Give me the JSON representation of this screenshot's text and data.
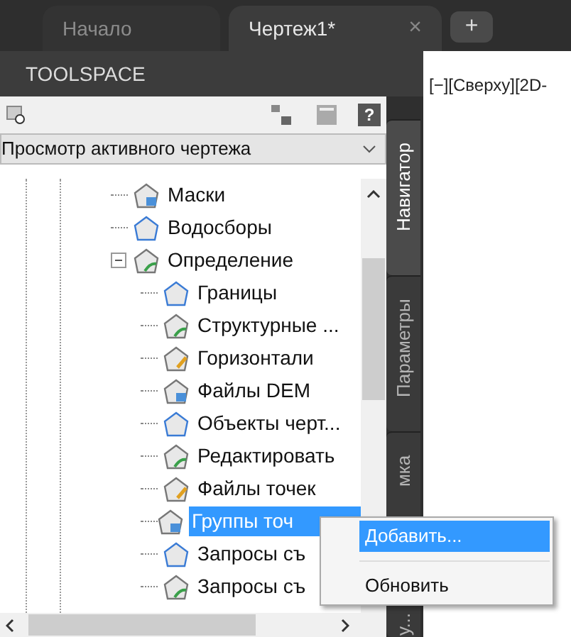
{
  "doc_tabs": [
    {
      "label": "Начало",
      "selected": false
    },
    {
      "label": "Чертеж1*",
      "selected": true,
      "close": "×"
    }
  ],
  "new_tab": "+",
  "panel": {
    "title": "TOOLSPACE",
    "help": "?",
    "view_select": {
      "value": "Просмотр активного чертежа"
    }
  },
  "tree": [
    {
      "label": "Маски",
      "selected": false
    },
    {
      "label": "Водосборы",
      "selected": false
    },
    {
      "label": "Определение",
      "selected": false,
      "expanded": true,
      "children": [
        {
          "label": "Границы",
          "selected": false
        },
        {
          "label": "Структурные ...",
          "selected": false
        },
        {
          "label": "Горизонтали",
          "selected": false
        },
        {
          "label": "Файлы DEM",
          "selected": false
        },
        {
          "label": "Объекты черт...",
          "selected": false
        },
        {
          "label": "Редактировать",
          "selected": false
        },
        {
          "label": "Файлы точек",
          "selected": false
        },
        {
          "label": "Группы точ",
          "selected": true
        },
        {
          "label": "Запросы съ",
          "selected": false
        },
        {
          "label": "Запросы съ",
          "selected": false
        }
      ]
    }
  ],
  "side_tabs": [
    {
      "label": "Навигатор",
      "selected": true
    },
    {
      "label": "Параметры",
      "selected": false
    },
    {
      "label": "мка",
      "selected": false
    },
    {
      "label": "у...",
      "selected": false
    }
  ],
  "viewport": {
    "label": "[−][Сверху][2D-"
  },
  "context_menu": [
    {
      "label": "Добавить...",
      "selected": true
    },
    {
      "label": "Обновить",
      "selected": false
    }
  ]
}
